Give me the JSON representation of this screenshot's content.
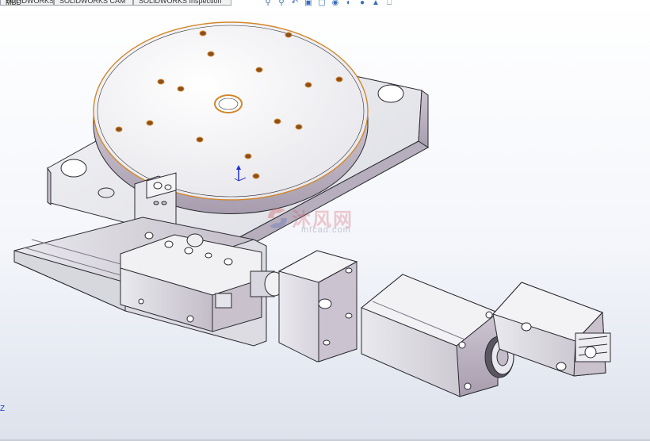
{
  "tabs": [
    {
      "label": "SOLIDWORKS MBD"
    },
    {
      "label": "SOLIDWORKS CAM"
    },
    {
      "label": "SOLIDWORKS Inspection"
    }
  ],
  "view_toolbar": {
    "icons": [
      "zoom-to-fit-icon",
      "zoom-area-icon",
      "previous-view-icon",
      "section-view-icon",
      "view-orientation-icon",
      "display-style-icon",
      "hide-show-icon",
      "edit-appearance-icon",
      "apply-scene-icon",
      "view-settings-icon"
    ]
  },
  "watermark": {
    "text": "沐风网",
    "url": "mfcad.com"
  },
  "triad": {
    "axis_label": "Z"
  },
  "colors": {
    "background_top": "#ffffff",
    "background_bottom": "#dde2ec",
    "edge_highlight": "#d4862a",
    "steel": "#d9dbe2",
    "steel_shadow": "#a69cae"
  }
}
